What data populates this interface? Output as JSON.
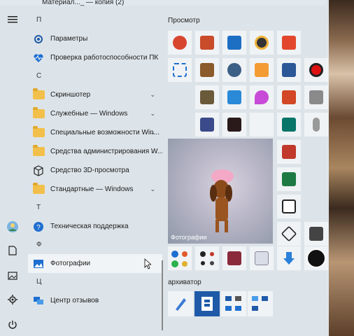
{
  "window_title": "Материал..._ — копия (2)",
  "list": {
    "letters": {
      "p": "П",
      "s": "С",
      "t": "Т",
      "f": "Ф",
      "ts": "Ц"
    },
    "items_p": [
      {
        "label": "Параметры"
      },
      {
        "label": "Проверка работоспособности ПК"
      }
    ],
    "items_s": [
      {
        "label": "Скриншотер"
      },
      {
        "label": "Служебные — Windows"
      },
      {
        "label": "Специальные возможности Win..."
      },
      {
        "label": "Средства администрирования W..."
      },
      {
        "label": "Средство 3D-просмотра"
      },
      {
        "label": "Стандартные — Windows"
      }
    ],
    "item_t": "Техническая поддержка",
    "item_f": "Фотографии",
    "item_ts": "Центр отзывов"
  },
  "groups": {
    "prosmotr": "Просмотр",
    "arkhivator": "архиватор"
  },
  "photo_tile_label": "Фотографии",
  "colors": {
    "folder": "#f2c04a",
    "accent": "#1e5aa8"
  }
}
